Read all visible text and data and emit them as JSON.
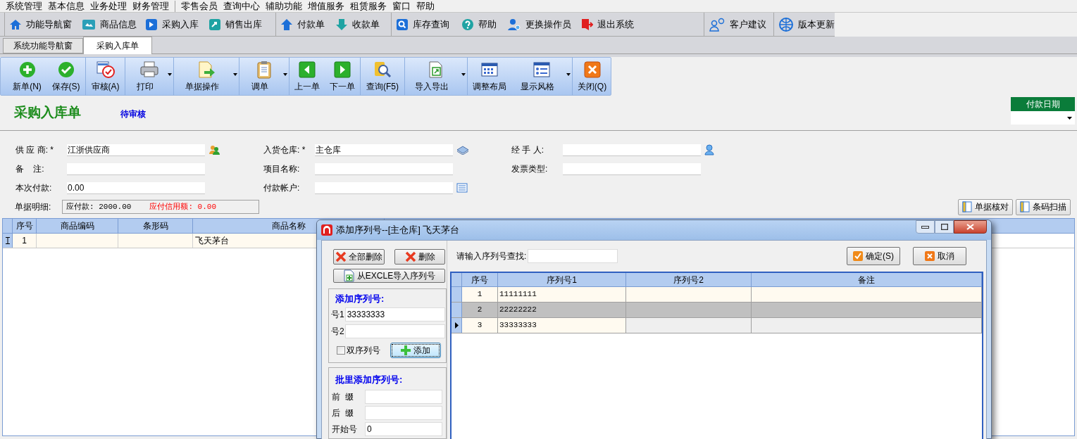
{
  "menu_bar": {
    "groups": [
      [
        "系统管理",
        "基本信息",
        "业务处理",
        "财务管理"
      ],
      [
        "零售会员",
        "查询中心",
        "辅助功能",
        "增值服务",
        "租赁服务",
        "窗口",
        "帮助"
      ]
    ]
  },
  "nav_toolbar": {
    "groups": [
      [
        "功能导航窗",
        "商品信息",
        "采购入库",
        "销售出库"
      ],
      [
        "付款单",
        "收款单"
      ],
      [
        "库存查询",
        "帮助",
        "更换操作员",
        "退出系统"
      ],
      [
        "客户建议"
      ],
      [
        "版本更新"
      ]
    ]
  },
  "tabs": [
    {
      "label": "系统功能导航窗",
      "selected": false
    },
    {
      "label": "采购入库单",
      "selected": true
    }
  ],
  "action_toolbar": {
    "groups": [
      [
        {
          "label": "新单(N)",
          "dropdown": false
        },
        {
          "label": "保存(S)",
          "dropdown": false
        }
      ],
      [
        {
          "label": "审核(A)",
          "dropdown": false
        }
      ],
      [
        {
          "label": "打印",
          "dropdown": true
        }
      ],
      [
        {
          "label": "单据操作",
          "dropdown": true
        }
      ],
      [
        {
          "label": "调单",
          "dropdown": true
        }
      ],
      [
        {
          "label": "上一单",
          "dropdown": false
        },
        {
          "label": "下一单",
          "dropdown": false
        }
      ],
      [
        {
          "label": "查询(F5)",
          "dropdown": false
        }
      ],
      [
        {
          "label": "导入导出",
          "dropdown": true
        }
      ],
      [
        {
          "label": "调整布局",
          "dropdown": false
        },
        {
          "label": "显示风格",
          "dropdown": true
        }
      ],
      [
        {
          "label": "关闭(Q)",
          "dropdown": false
        }
      ]
    ]
  },
  "document": {
    "title": "采购入库单",
    "status": "待审核",
    "payment_date": {
      "label": "付款日期"
    }
  },
  "form": {
    "rows": [
      [
        {
          "label": "供 应 商: *",
          "value": "江浙供应商",
          "icon": true
        },
        {
          "label": "入货仓库: *",
          "value": "主仓库",
          "icon": true
        },
        {
          "label": "经 手 人:",
          "icon": true
        }
      ],
      [
        {
          "label": "备    注:",
          "icon": false
        },
        {
          "label": "项目名称:",
          "icon": false
        },
        {
          "label": "发票类型:",
          "icon": false
        }
      ],
      [
        {
          "label": "本次付款:",
          "value": "0.00",
          "icon": false
        },
        {
          "label": "付款帐户:",
          "icon": true
        }
      ]
    ]
  },
  "summary": {
    "label": "单据明细:",
    "payable": "应付款: 2000.00",
    "credit": "应付信用额: 0.00"
  },
  "detail_buttons": [
    "单据核对",
    "条码扫描"
  ],
  "detail_table": {
    "columns": [
      "序号",
      "商品编码",
      "条形码",
      "商品名称"
    ],
    "rows": [
      {
        "cells": [
          "1",
          "",
          "",
          "飞天茅台"
        ],
        "editing": true
      }
    ]
  },
  "dialog": {
    "title": "添加序列号--[主仓库] 飞天茅台",
    "left_buttons": [
      "全部删除",
      "删除",
      "从EXCLE导入序列号"
    ],
    "add_group": {
      "title": "添加序列号:",
      "fields": [
        {
          "label": "号1",
          "value": "33333333"
        },
        {
          "label": "号2"
        }
      ],
      "double_serial": {
        "label": "双序列号",
        "checked": false
      },
      "add_button": "添加"
    },
    "batch_group": {
      "title": "批里添加序列号:",
      "fields": [
        {
          "label": "前  缀"
        },
        {
          "label": "后  缀"
        },
        {
          "label": "开始号",
          "value": "0"
        }
      ]
    },
    "search_label": "请输入序列号查找:",
    "confirm_button": "确定(S)",
    "cancel_button": "取消",
    "grid": {
      "columns": [
        "序号",
        "序列号1",
        "序列号2",
        "备注"
      ],
      "rows": [
        {
          "cells": [
            "1",
            "11111111",
            "",
            ""
          ],
          "selected": false,
          "current": false
        },
        {
          "cells": [
            "2",
            "22222222",
            "",
            ""
          ],
          "selected": true,
          "current": false
        },
        {
          "cells": [
            "3",
            "33333333",
            "",
            ""
          ],
          "selected": false,
          "current": true
        }
      ]
    }
  }
}
